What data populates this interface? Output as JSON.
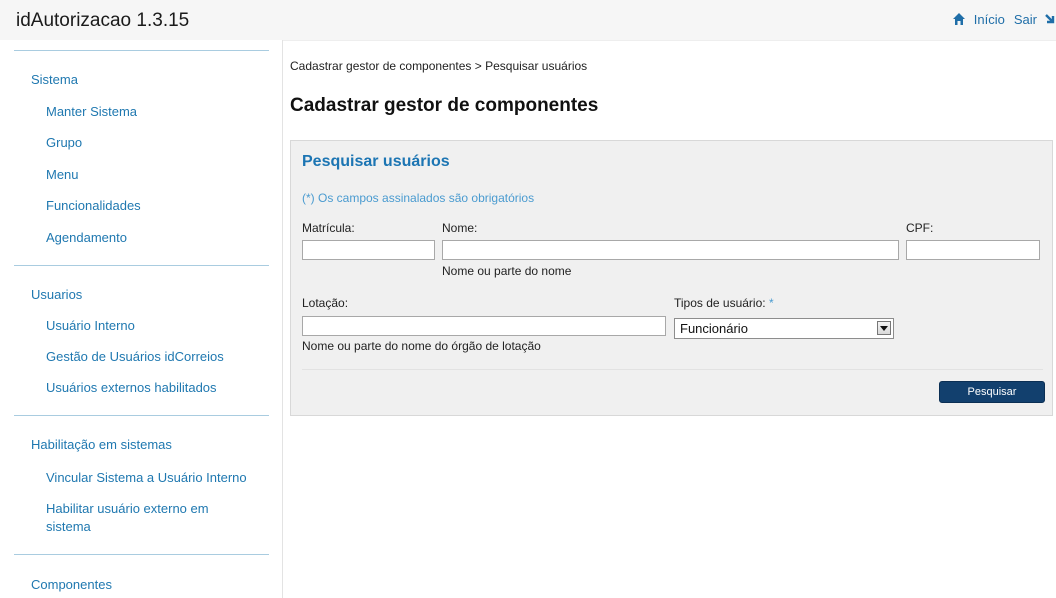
{
  "app": {
    "title": "idAutorizacao 1.3.15"
  },
  "topnav": {
    "inicio_label": "Início",
    "sair_label": "Sair"
  },
  "sidebar": {
    "sections": [
      {
        "label": "Sistema",
        "items": [
          {
            "label": "Manter Sistema"
          },
          {
            "label": "Grupo"
          },
          {
            "label": "Menu"
          },
          {
            "label": "Funcionalidades"
          },
          {
            "label": "Agendamento"
          }
        ]
      },
      {
        "label": "Usuarios",
        "items": [
          {
            "label": "Usuário Interno"
          },
          {
            "label": "Gestão de Usuários idCorreios"
          },
          {
            "label": "Usuários externos habilitados"
          }
        ]
      },
      {
        "label": "Habilitação em sistemas",
        "items": [
          {
            "label": "Vincular Sistema a Usuário Interno"
          },
          {
            "label": "Habilitar usuário externo em sistema"
          }
        ]
      },
      {
        "label": "Componentes",
        "items": []
      }
    ]
  },
  "breadcrumb": "Cadastrar gestor de componentes > Pesquisar usuários",
  "page_title": "Cadastrar gestor de componentes",
  "search": {
    "title": "Pesquisar usuários",
    "required_note": "(*) Os campos assinalados são obrigatórios",
    "matricula": {
      "label": "Matrícula:",
      "value": ""
    },
    "nome": {
      "label": "Nome:",
      "value": "",
      "hint": "Nome ou parte do nome"
    },
    "cpf": {
      "label": "CPF:",
      "value": ""
    },
    "lotacao": {
      "label": "Lotação:",
      "value": "",
      "hint": "Nome ou parte do nome do órgão de lotação"
    },
    "tipo": {
      "label": "Tipos de usuário:",
      "required_mark": "*",
      "selected": "Funcionário"
    },
    "button_label": "Pesquisar"
  },
  "colors": {
    "link": "#1f78b0",
    "panel_title": "#1c75b3",
    "required_note": "#4a9bd0",
    "button_bg": "#12406e",
    "panel_bg": "#f0f0f0"
  },
  "icons": {
    "home": "home-icon",
    "exit": "exit-arrow-icon",
    "dropdown": "chevron-down-icon"
  }
}
